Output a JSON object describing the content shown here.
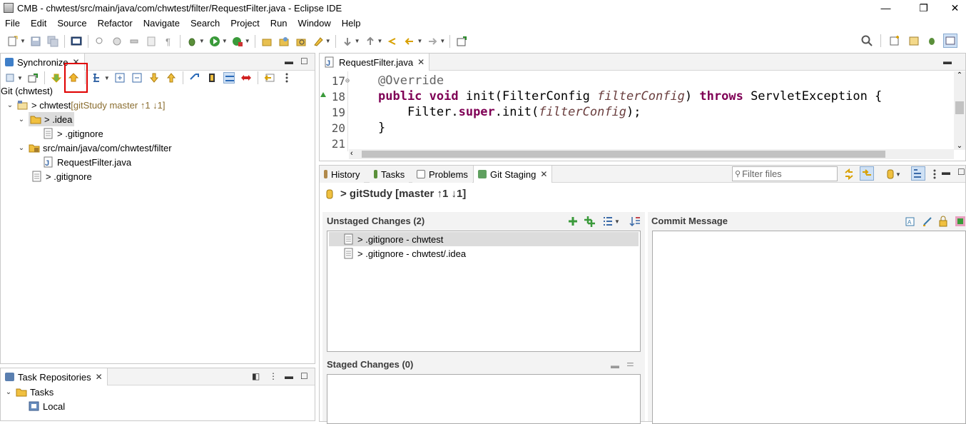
{
  "window": {
    "title": "CMB - chwtest/src/main/java/com/chwtest/filter/RequestFilter.java - Eclipse IDE",
    "minimize": "—",
    "restore": "❐",
    "close": "✕"
  },
  "menu": [
    "File",
    "Edit",
    "Source",
    "Refactor",
    "Navigate",
    "Search",
    "Project",
    "Run",
    "Window",
    "Help"
  ],
  "synchronize_view": {
    "tab_label": "Synchronize",
    "close": "✕",
    "header": "Git (chwtest)",
    "tree": [
      {
        "label": "> chwtest",
        "extra": " [gitStudy master ↑1 ↓1]",
        "icon": "project-icon"
      },
      {
        "label": "> .idea",
        "icon": "folder-icon"
      },
      {
        "label": "> .gitignore",
        "icon": "file-icon"
      },
      {
        "label": "src/main/java/com/chwtest/filter",
        "icon": "package-icon"
      },
      {
        "label": "RequestFilter.java",
        "icon": "java-file-icon"
      },
      {
        "label": "> .gitignore",
        "icon": "file-icon"
      }
    ]
  },
  "task_repositories": {
    "tab_label": "Task Repositories",
    "close": "✕",
    "items": [
      {
        "label": "Tasks"
      },
      {
        "label": "Local"
      }
    ]
  },
  "editor": {
    "tab_label": "RequestFilter.java",
    "close": "✕",
    "line_numbers": [
      "17",
      "18",
      "19",
      "20",
      "21"
    ],
    "code": {
      "l17_ann": "@Override",
      "l18_kw1": "public",
      "l18_kw2": "void",
      "l18_a": " init(FilterConfig ",
      "l18_param": "filterConfig",
      "l18_b": ") ",
      "l18_kw3": "throws",
      "l18_c": " ServletException {",
      "l19_a": "    Filter.",
      "l19_kw": "super",
      "l19_b": ".init(",
      "l19_param": "filterConfig",
      "l19_c": ");",
      "l20": "}"
    }
  },
  "bottom_tabs": {
    "history": "History",
    "tasks": "Tasks",
    "problems": "Problems",
    "git_staging": "Git Staging",
    "close": "✕",
    "filter_placeholder": "Filter files"
  },
  "git_staging": {
    "repo_title": "> gitStudy [master ↑1 ↓1]",
    "unstaged_title": "Unstaged Changes (2)",
    "unstaged": [
      {
        "label": "> .gitignore - chwtest"
      },
      {
        "label": "> .gitignore - chwtest/.idea"
      }
    ],
    "staged_title": "Staged Changes (0)",
    "commit_message_title": "Commit Message"
  },
  "colors": {
    "keyword": "#7f0055",
    "highlight_box": "#e00000",
    "selection": "#dcdcdc"
  }
}
